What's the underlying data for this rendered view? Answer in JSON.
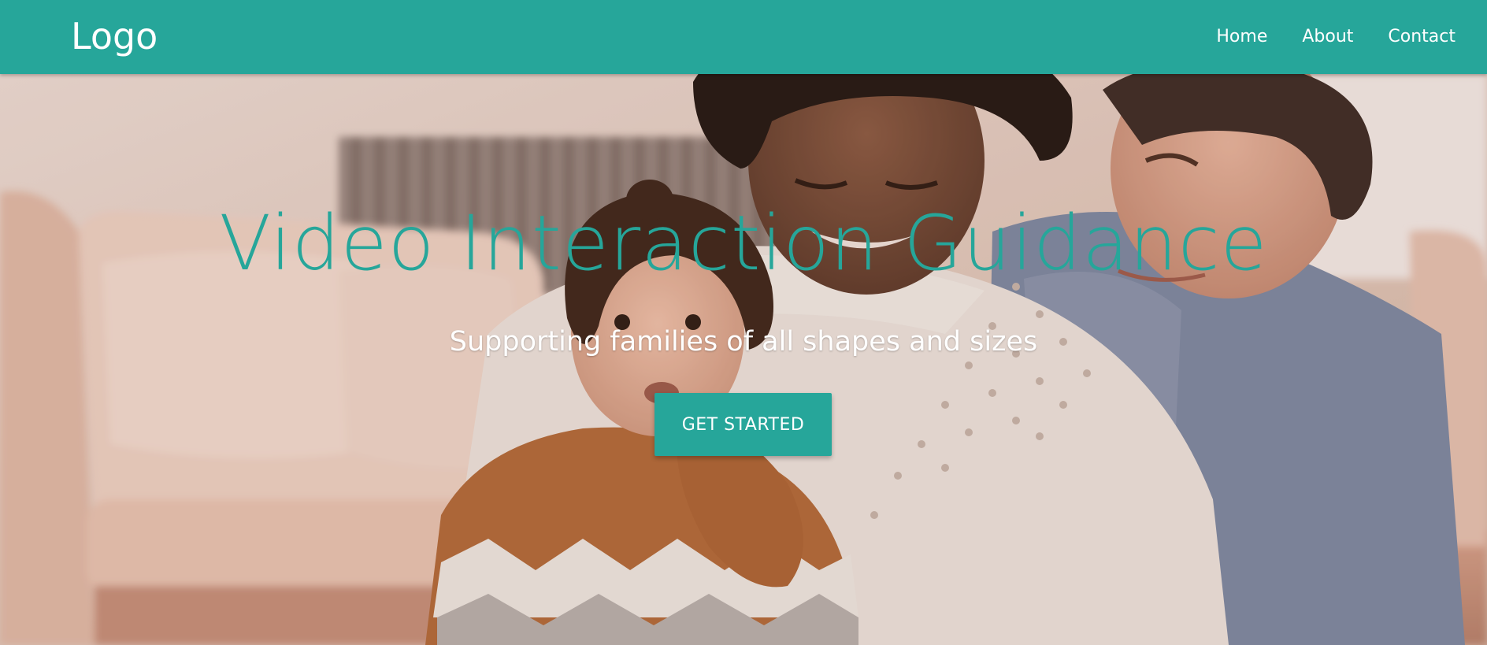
{
  "navbar": {
    "logo": "Logo",
    "links": [
      "Home",
      "About",
      "Contact"
    ],
    "background": "#26a69a"
  },
  "hero": {
    "title": "Video Interaction Guidance",
    "subtitle": "Supporting families of all shapes and sizes",
    "cta_label": "GET STARTED",
    "title_color": "#26a69a",
    "image_description_icon": "family-photo"
  }
}
